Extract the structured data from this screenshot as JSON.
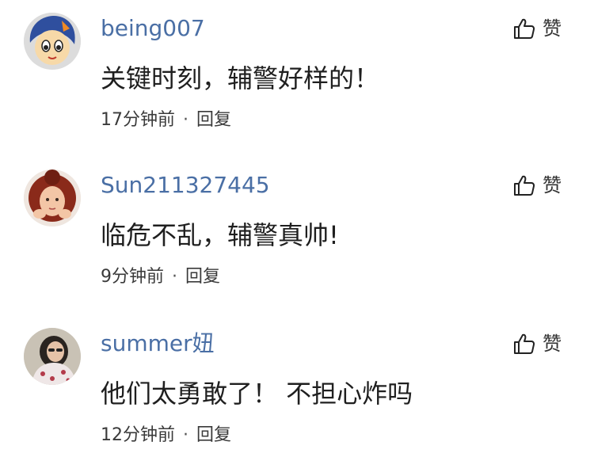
{
  "comments": [
    {
      "username": "being007",
      "content": "关键时刻，辅警好样的！",
      "time": "17分钟前",
      "separator": "·",
      "reply": "回复",
      "like_label": "赞",
      "avatar_icon": "cartoon-face-avatar"
    },
    {
      "username": "Sun211327445",
      "content": "临危不乱，辅警真帅!",
      "time": "9分钟前",
      "separator": "·",
      "reply": "回复",
      "like_label": "赞",
      "avatar_icon": "red-haired-girl-avatar"
    },
    {
      "username": "summer妞",
      "content": "他们太勇敢了！ 不担心炸吗",
      "time": "12分钟前",
      "separator": "·",
      "reply": "回复",
      "like_label": "赞",
      "avatar_icon": "woman-photo-avatar"
    }
  ],
  "colors": {
    "username": "#4a6fa5",
    "text": "#1f1f1f",
    "meta": "#3a3a3a"
  },
  "icons": {
    "like": "thumbs-up-icon"
  }
}
